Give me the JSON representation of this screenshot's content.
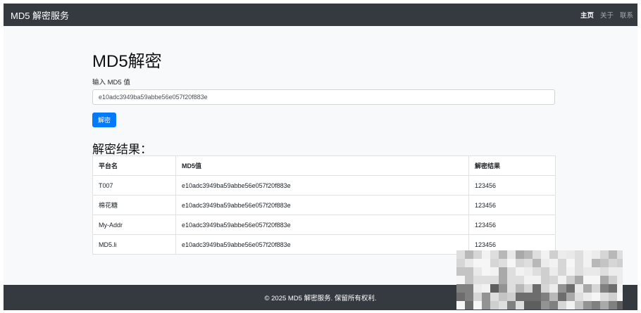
{
  "navbar": {
    "brand": "MD5 解密服务",
    "links": [
      {
        "label": "主页",
        "active": true
      },
      {
        "label": "关于",
        "active": false
      },
      {
        "label": "联系",
        "active": false
      }
    ]
  },
  "main": {
    "title": "MD5解密",
    "input_label": "输入 MD5 值",
    "input_value": "e10adc3949ba59abbe56e057f20f883e",
    "submit_label": "解密",
    "results_title": "解密结果：",
    "table": {
      "headers": [
        "平台名",
        "MD5值",
        "解密结果"
      ],
      "rows": [
        [
          "T007",
          "e10adc3949ba59abbe56e057f20f883e",
          "123456"
        ],
        [
          "棉花糖",
          "e10adc3949ba59abbe56e057f20f883e",
          "123456"
        ],
        [
          "My-Addr",
          "e10adc3949ba59abbe56e057f20f883e",
          "123456"
        ],
        [
          "MD5.li",
          "e10adc3949ba59abbe56e057f20f883e",
          "123456"
        ]
      ]
    }
  },
  "footer": {
    "text": "© 2025 MD5 解密服务. 保留所有权利."
  },
  "colors": {
    "navbar_bg": "#343a40",
    "page_bg": "#f8f9fa",
    "button_bg": "#007bff"
  }
}
